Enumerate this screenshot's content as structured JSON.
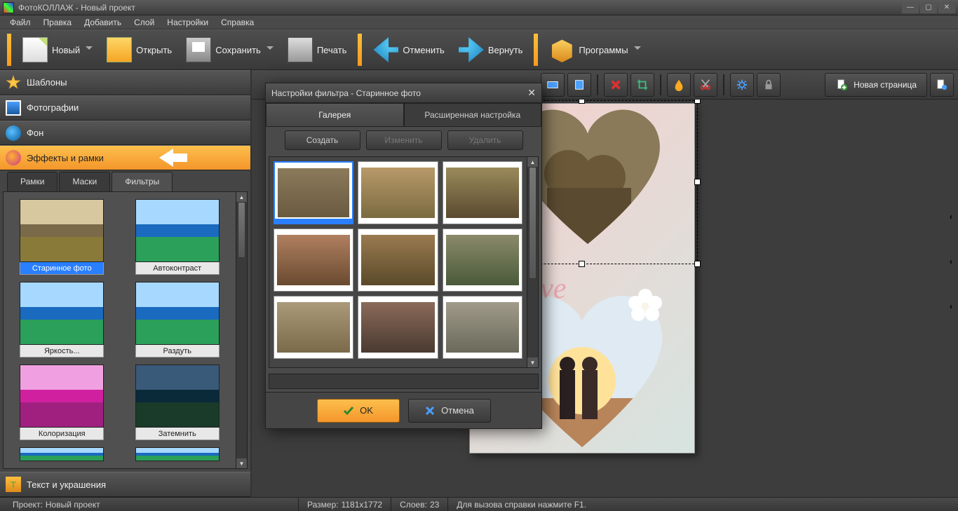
{
  "title": "ФотоКОЛЛАЖ - Новый проект",
  "menu": {
    "items": [
      "Файл",
      "Правка",
      "Добавить",
      "Слой",
      "Настройки",
      "Справка"
    ]
  },
  "toolbar": {
    "new": "Новый",
    "open": "Открыть",
    "save": "Сохранить",
    "print": "Печать",
    "undo": "Отменить",
    "redo": "Вернуть",
    "programs": "Программы"
  },
  "sidebar": {
    "accordion": [
      {
        "key": "templates",
        "label": "Шаблоны"
      },
      {
        "key": "photos",
        "label": "Фотографии"
      },
      {
        "key": "background",
        "label": "Фон"
      },
      {
        "key": "effects",
        "label": "Эффекты и рамки"
      },
      {
        "key": "text",
        "label": "Текст и украшения"
      }
    ],
    "subtabs": {
      "frames": "Рамки",
      "masks": "Маски",
      "filters": "Фильтры"
    },
    "filters": [
      {
        "label": "Старинное фото",
        "sel": true
      },
      {
        "label": "Автоконтраст"
      },
      {
        "label": "Яркость..."
      },
      {
        "label": "Раздуть"
      },
      {
        "label": "Колоризация"
      },
      {
        "label": "Затемнить"
      }
    ]
  },
  "proptoolbar": {
    "newpage": "Новая страница"
  },
  "canvas": {
    "text": "ur Love"
  },
  "dialog": {
    "title": "Настройки фильтра - Старинное фото",
    "tabs": {
      "gallery": "Галерея",
      "advanced": "Расширенная настройка"
    },
    "actions": {
      "create": "Создать",
      "edit": "Изменить",
      "delete": "Удалить"
    },
    "ok": "OK",
    "cancel": "Отмена"
  },
  "status": {
    "project_label": "Проект:",
    "project": "Новый проект",
    "size_label": "Размер:",
    "size": "1181x1772",
    "layers_label": "Слоев:",
    "layers": "23",
    "hint": "Для вызова справки нажмите F1."
  }
}
